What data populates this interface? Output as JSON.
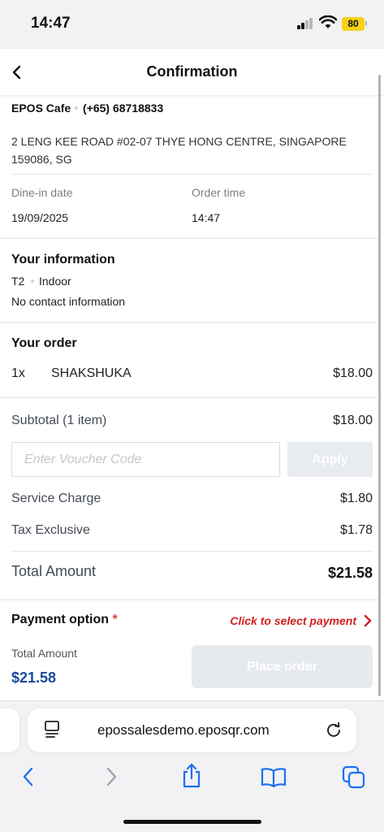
{
  "status_bar": {
    "time": "14:47",
    "battery": "80",
    "icons": [
      "signal-icon",
      "wifi-icon",
      "battery-icon"
    ]
  },
  "header": {
    "title": "Confirmation",
    "back_icon": "chevron-left-icon"
  },
  "shop": {
    "name": "EPOS Cafe",
    "phone": "(+65) 68718833",
    "address": "2 LENG KEE ROAD #02-07 THYE HONG CENTRE, SINGAPORE 159086, SG"
  },
  "dine_in": {
    "date_label": "Dine-in date",
    "date_value": "19/09/2025",
    "time_label": "Order time",
    "time_value": "14:47"
  },
  "your_information": {
    "title": "Your information",
    "table": "T2",
    "area": "Indoor",
    "contact": "No contact information"
  },
  "your_order": {
    "title": "Your order",
    "items": [
      {
        "qty": "1x",
        "name": "SHAKSHUKA",
        "price": "$18.00"
      }
    ]
  },
  "summary": {
    "subtotal_label": "Subtotal (1 item)",
    "subtotal_value": "$18.00",
    "voucher_placeholder": "Enter Voucher Code",
    "voucher_value": "",
    "apply_label": "Apply",
    "service_charge_label": "Service Charge",
    "service_charge_value": "$1.80",
    "tax_label": "Tax Exclusive",
    "tax_value": "$1.78",
    "total_label": "Total Amount",
    "total_value": "$21.58"
  },
  "payment": {
    "title": "Payment option",
    "required_mark": "*",
    "select_prompt": "Click to select payment",
    "total_label": "Total Amount",
    "total_value": "$21.58",
    "place_order_label": "Place order"
  },
  "browser": {
    "url": "epossalesdemo.eposqr.com",
    "toolbar_icons": [
      "back-icon",
      "forward-icon",
      "share-icon",
      "bookmarks-icon",
      "tabs-icon"
    ]
  },
  "colors": {
    "accent_blue": "#1a4a9e",
    "alert_red": "#d11f1f",
    "disabled_button": "#e6e9ee",
    "browser_blue": "#1e6ff2"
  }
}
